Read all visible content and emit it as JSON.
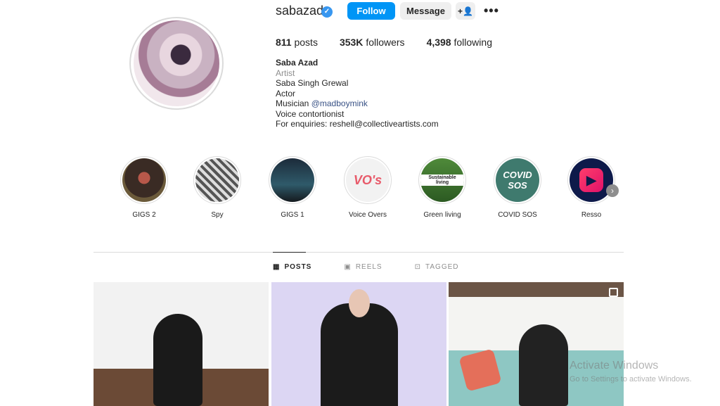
{
  "profile": {
    "username": "sabazad",
    "verified_icon": "verified-badge-icon",
    "follow_label": "Follow",
    "message_label": "Message",
    "suggest_icon": "add-user-icon",
    "more_label": "•••"
  },
  "stats": {
    "posts": "811",
    "posts_label": "posts",
    "followers": "353K",
    "followers_label": "followers",
    "following": "4,398",
    "following_label": "following"
  },
  "bio": {
    "name": "Saba Azad",
    "category": "Artist",
    "line1": "Saba Singh Grewal",
    "line2": "Actor",
    "line3_prefix": "Musician",
    "line3_mention": "@madboymink",
    "line4": "Voice contortionist",
    "line5": "For enquiries: reshell@collectiveartists.com"
  },
  "highlights": [
    {
      "label": "GIGS 2"
    },
    {
      "label": "Spy"
    },
    {
      "label": "GIGS 1"
    },
    {
      "label": "Voice Overs",
      "cover_text": "VO's"
    },
    {
      "label": "Green living",
      "cover_text": "Sustainable living"
    },
    {
      "label": "COVID SOS",
      "cover_text": "COVID SOS"
    },
    {
      "label": "Resso"
    }
  ],
  "tabs": [
    {
      "label": "POSTS",
      "icon": "grid-icon"
    },
    {
      "label": "REELS",
      "icon": "reels-icon"
    },
    {
      "label": "TAGGED",
      "icon": "tagged-icon"
    }
  ],
  "watermark": {
    "line1": "Activate Windows",
    "line2": "Go to Settings to activate Windows."
  },
  "colors": {
    "accent": "#0095f6",
    "verified": "#3897f0",
    "mention": "#385185",
    "covid_bg": "#3f7a6e",
    "resso_bg": "#0e1a4a"
  }
}
